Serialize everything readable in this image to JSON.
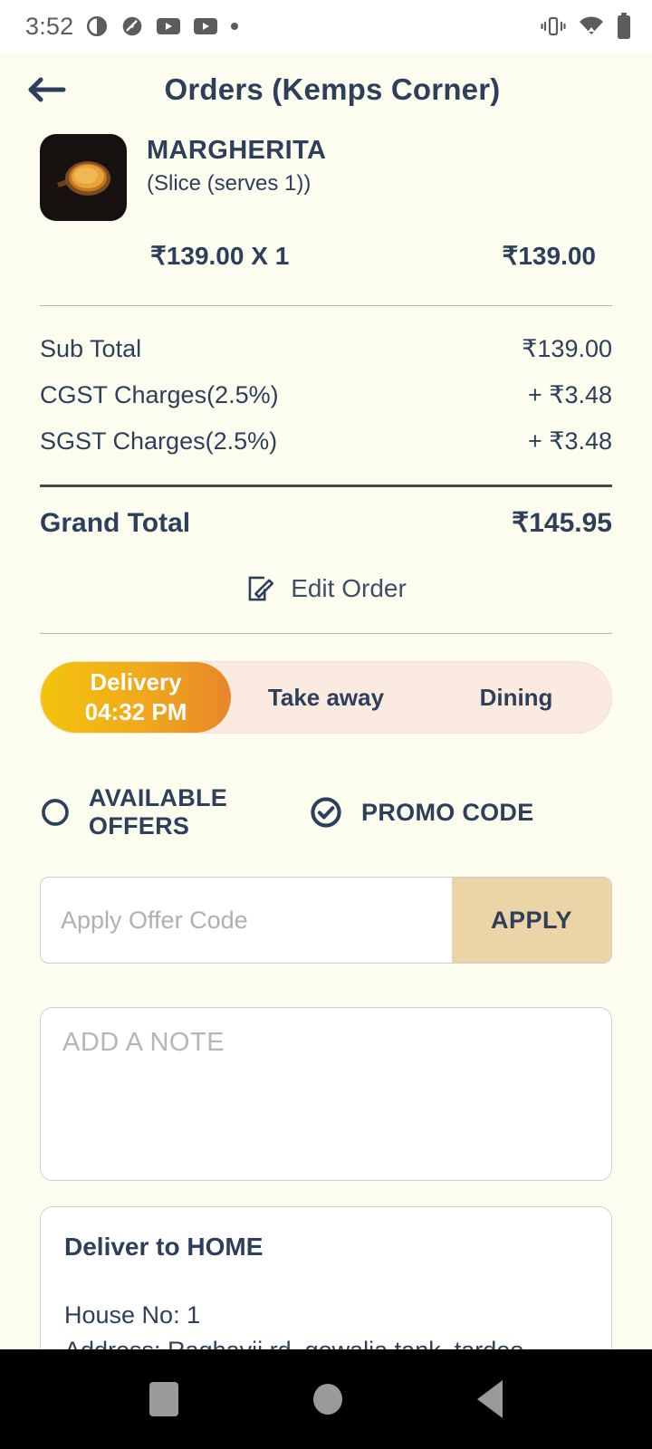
{
  "status_bar": {
    "time": "3:52",
    "left_icons": [
      "brightness-icon",
      "speedometer-icon",
      "youtube-icon",
      "youtube-icon",
      "dot-icon"
    ],
    "right_icons": [
      "vibrate-icon",
      "wifi-icon",
      "battery-icon"
    ]
  },
  "header": {
    "back_icon": "back-arrow-icon",
    "title": "Orders (Kemps Corner)"
  },
  "order_item": {
    "thumbnail": "pizza-thumbnail",
    "name": "MARGHERITA",
    "variant": "(Slice (serves 1))",
    "unit_price_qty": "₹139.00 X 1",
    "line_total": "₹139.00"
  },
  "totals": {
    "rows": [
      {
        "label": "Sub Total",
        "value": "₹139.00"
      },
      {
        "label": "CGST Charges(2.5%)",
        "value": "+ ₹3.48"
      },
      {
        "label": "SGST Charges(2.5%)",
        "value": "+ ₹3.48"
      }
    ],
    "grand_label": "Grand Total",
    "grand_value": "₹145.95"
  },
  "edit_order": {
    "icon": "edit-pencil-icon",
    "label": "Edit Order"
  },
  "order_type_tabs": {
    "selected": "Delivery",
    "items": [
      {
        "label": "Delivery",
        "sub": "04:32 PM",
        "active": true
      },
      {
        "label": "Take away",
        "sub": "",
        "active": false
      },
      {
        "label": "Dining",
        "sub": "",
        "active": false
      }
    ]
  },
  "offer_options": [
    {
      "label": "AVAILABLE OFFERS",
      "selected": false,
      "icon": "radio-unchecked-icon"
    },
    {
      "label": "PROMO CODE",
      "selected": true,
      "icon": "radio-checked-icon"
    }
  ],
  "promo": {
    "value": "",
    "placeholder": "Apply Offer Code",
    "apply_label": "APPLY"
  },
  "note": {
    "value": "",
    "placeholder": "ADD A NOTE"
  },
  "address": {
    "title": "Deliver to HOME",
    "house": "House No: 1",
    "address": "Address: Raghavji rd, gowalia tank, tardeo"
  },
  "nav_bar": {
    "recents": "square-recents-icon",
    "home": "circle-home-icon",
    "back": "triangle-back-icon"
  },
  "colors": {
    "page_bg": "#FCFDEE",
    "navy": "#2E3F5C",
    "tab_track": "#FBEADF",
    "gradient_start": "#F3C40C",
    "gradient_end": "#E8862C",
    "apply_bg": "#EBD5A6"
  }
}
